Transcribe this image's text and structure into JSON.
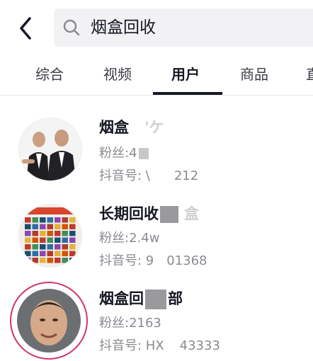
{
  "search": {
    "query": "烟盒回收"
  },
  "tabs": [
    {
      "label": "综合"
    },
    {
      "label": "视频"
    },
    {
      "label": "用户",
      "active": true
    },
    {
      "label": "商品"
    },
    {
      "label": "直"
    }
  ],
  "users": [
    {
      "name": "烟盒",
      "name_tail": "'ケ",
      "fans": "粉丝:4",
      "douyin_id_prefix": "抖音号: \\",
      "douyin_id_suffix": "212"
    },
    {
      "name": "长期回收",
      "name_tail": "盒",
      "fans": "粉丝:2.4w",
      "douyin_id_prefix": "抖音号: 9",
      "douyin_id_suffix": "01368"
    },
    {
      "name": "烟盒回",
      "name_tail": "部",
      "fans": "粉丝:2163",
      "douyin_id_prefix": "抖音号: HX",
      "douyin_id_suffix": "43333"
    }
  ],
  "colors": {
    "accent_ring": "#d2346b",
    "tab_indicator": "#161823",
    "search_bg": "#f2f2f4"
  },
  "icons": [
    "back-arrow-icon",
    "search-icon"
  ]
}
